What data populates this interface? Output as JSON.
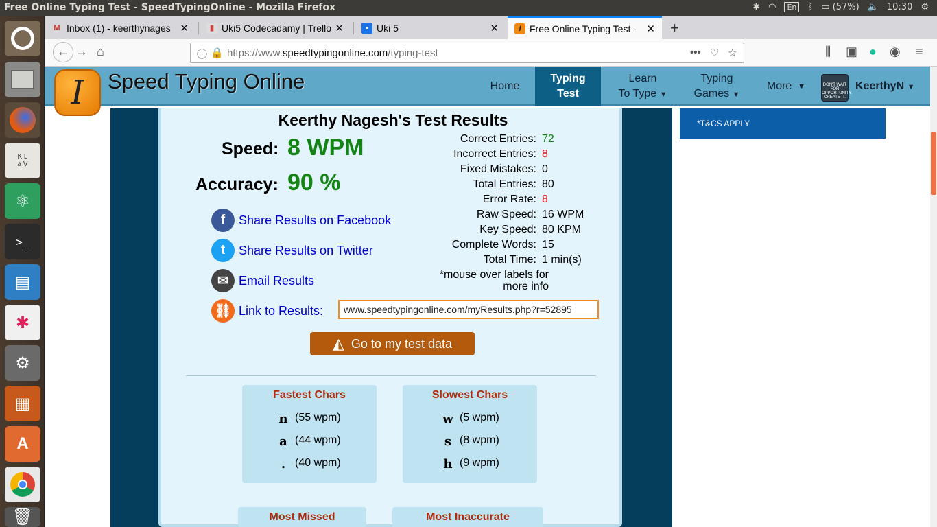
{
  "os": {
    "window_title": "Free Online Typing Test - SpeedTypingOnline - Mozilla Firefox",
    "keyboard_layout": "En",
    "battery": "(57%)",
    "clock": "10:30"
  },
  "browser": {
    "tabs": [
      {
        "label": "Inbox (1) - keerthynages",
        "icon": "gmail-icon"
      },
      {
        "label": "Uki5 Codecadamy | Trello",
        "icon": "trello-icon"
      },
      {
        "label": "Uki 5",
        "icon": "classroom-icon"
      },
      {
        "label": "Free Online Typing Test -",
        "icon": "sto-favicon"
      }
    ],
    "url_scheme": "https://www.",
    "url_domain": "speedtypingonline.com",
    "url_path": "/typing-test"
  },
  "site": {
    "name": "Speed Typing Online",
    "nav": {
      "home": "Home",
      "typing_test_1": "Typing",
      "typing_test_2": "Test",
      "learn_1": "Learn",
      "learn_2": "To Type",
      "games_1": "Typing",
      "games_2": "Games",
      "more": "More",
      "arrow": "▼"
    },
    "user": "KeerthyN",
    "avatar_text": "DON'T WAIT FOR OPPORTUNITY. CREATE IT."
  },
  "ad": {
    "text": "*T&CS APPLY"
  },
  "results": {
    "title": "Keerthy Nagesh's Test Results",
    "speed_label": "Speed:",
    "speed_value": "8 WPM",
    "accuracy_label": "Accuracy:",
    "accuracy_value": "90 %",
    "share": {
      "facebook": "Share Results on Facebook",
      "twitter": "Share Results on Twitter",
      "email": "Email Results",
      "link": "Link to Results:"
    },
    "link_value": "www.speedtypingonline.com/myResults.php?r=52895",
    "stats": [
      {
        "label": "Correct Entries:",
        "value": "72",
        "color": "#148414"
      },
      {
        "label": "Incorrect Entries:",
        "value": "8",
        "color": "#e01010"
      },
      {
        "label": "Fixed Mistakes:",
        "value": "0",
        "color": "#000000"
      },
      {
        "label": "Total Entries:",
        "value": "80",
        "color": "#000000"
      },
      {
        "label": "Error Rate:",
        "value": "8",
        "color": "#e01010"
      },
      {
        "label": "Raw Speed:",
        "value": "16 WPM",
        "color": "#000000"
      },
      {
        "label": "Key Speed:",
        "value": "80 KPM",
        "color": "#000000"
      },
      {
        "label": "Complete Words:",
        "value": "15",
        "color": "#000000"
      },
      {
        "label": "Total Time:",
        "value": "1 min(s)",
        "color": "#000000"
      }
    ],
    "mouseover_note": "*mouse over labels for more info",
    "go_button": "Go to my test data",
    "fastest": {
      "title": "Fastest Chars",
      "items": [
        {
          "char": "n",
          "wpm": "(55 wpm)"
        },
        {
          "char": "a",
          "wpm": "(44 wpm)"
        },
        {
          "char": ".",
          "wpm": "(40 wpm)"
        }
      ]
    },
    "slowest": {
      "title": "Slowest Chars",
      "items": [
        {
          "char": "w",
          "wpm": "(5 wpm)"
        },
        {
          "char": "s",
          "wpm": "(8 wpm)"
        },
        {
          "char": "h",
          "wpm": "(9 wpm)"
        }
      ]
    },
    "most_missed": "Most Missed",
    "most_inaccurate": "Most Inaccurate"
  },
  "colors": {
    "header": "#5fa8c8",
    "nav_active": "#0d5f86",
    "speed_green": "#148414",
    "error_red": "#e01010",
    "button_orange": "#b35a0c",
    "char_title": "#b02c0c"
  }
}
